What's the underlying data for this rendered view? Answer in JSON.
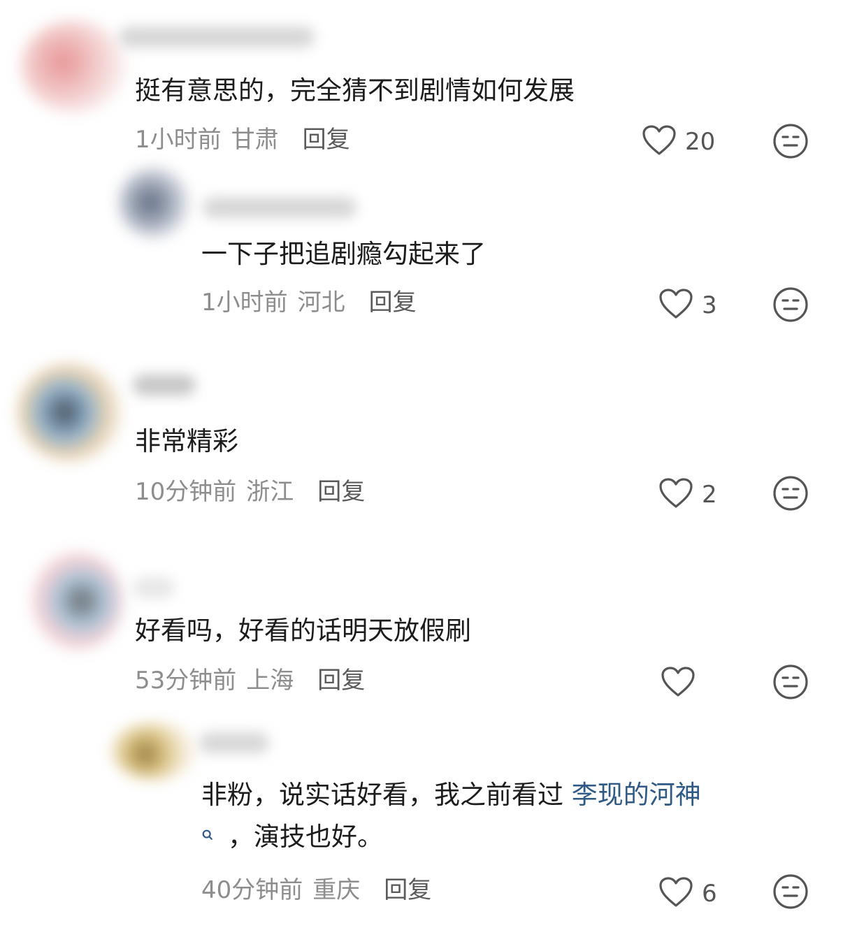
{
  "comments": [
    {
      "text": "挺有意思的，完全猜不到剧情如何发展",
      "time": "1小时前",
      "location": "甘肃",
      "reply": "回复",
      "likes": "20"
    },
    {
      "text": "一下子把追剧瘾勾起来了",
      "time": "1小时前",
      "location": "河北",
      "reply": "回复",
      "likes": "3"
    },
    {
      "text": "非常精彩",
      "time": "10分钟前",
      "location": "浙江",
      "reply": "回复",
      "likes": "2"
    },
    {
      "text": "好看吗，好看的话明天放假刷",
      "time": "53分钟前",
      "location": "上海",
      "reply": "回复",
      "likes": ""
    },
    {
      "text_before_link": "非粉，说实话好看，我之前看过 ",
      "link_text": "李现的河神",
      "text_after_link": "，演技也好。",
      "time": "40分钟前",
      "location": "重庆",
      "reply": "回复",
      "likes": "6"
    }
  ],
  "icons": {
    "like": "heart-outline-icon",
    "dislike": "meh-face-icon",
    "link_search": "search-icon"
  },
  "colors": {
    "text": "#1c1c1c",
    "meta": "#8d8d8d",
    "reply": "#5a5a5a",
    "link": "#2f5a86"
  }
}
